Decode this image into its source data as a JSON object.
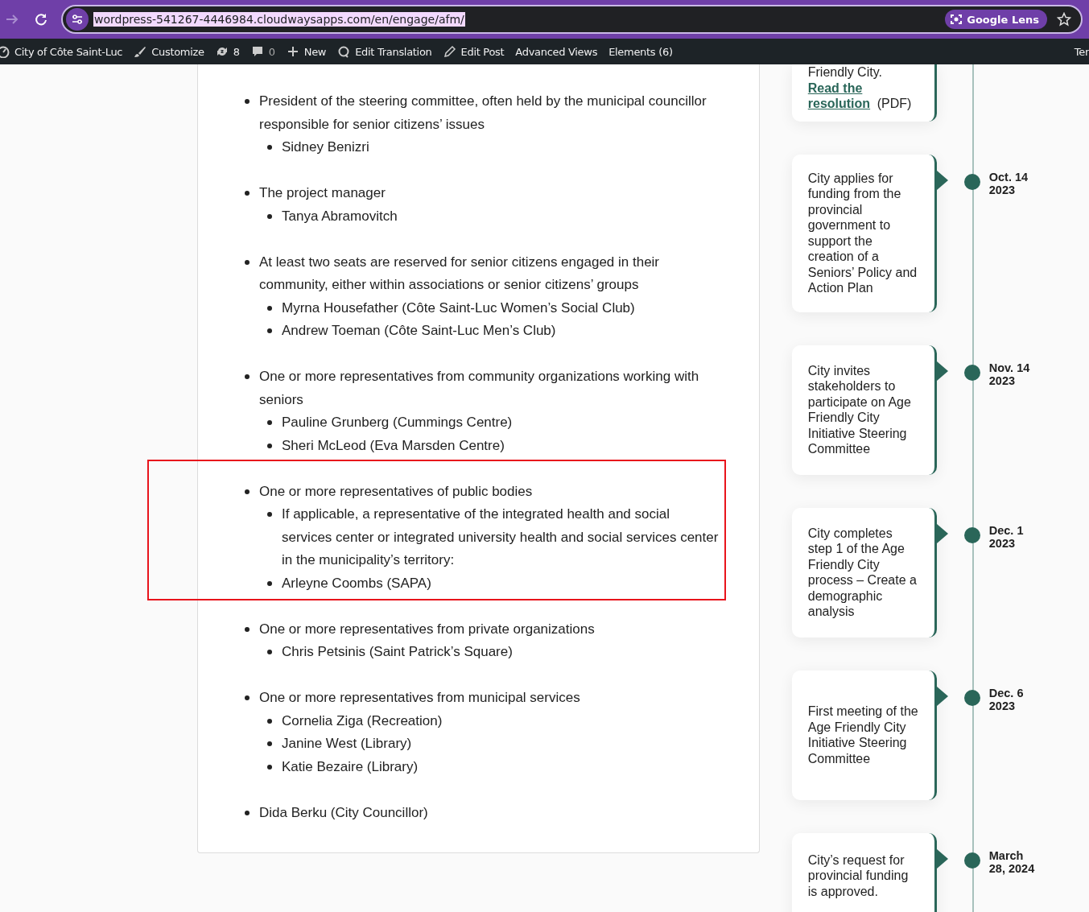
{
  "browser": {
    "url": "wordpress-541267-4446984.cloudwaysapps.com/en/engage/afm/",
    "lens_label": "Google Lens"
  },
  "admin_bar": {
    "items": [
      {
        "kind": "dashboard",
        "label": "City of Côte Saint-Luc"
      },
      {
        "kind": "brush",
        "label": "Customize"
      },
      {
        "kind": "refresh",
        "label": "8"
      },
      {
        "kind": "comment",
        "label": "0"
      },
      {
        "kind": "plus",
        "label": "New"
      },
      {
        "kind": "translate",
        "label": "Edit Translation"
      },
      {
        "kind": "pencil",
        "label": "Edit Post"
      },
      {
        "kind": "plain",
        "label": "Advanced Views"
      },
      {
        "kind": "plain",
        "label": "Elements (6)"
      }
    ],
    "right_label": "Ter"
  },
  "members": [
    {
      "text": "President of the steering committee, often held by the municipal councillor responsible for senior citizens’ issues",
      "highlighted": false,
      "children": [
        "Sidney Benizri"
      ]
    },
    {
      "text": "The project manager",
      "highlighted": false,
      "children": [
        "Tanya Abramovitch"
      ]
    },
    {
      "text": "At least two seats are reserved for senior citizens engaged in their community, either within associations or senior citizens’ groups",
      "highlighted": false,
      "children": [
        "Myrna Housefather (Côte Saint-Luc Women’s Social Club)",
        "Andrew Toeman (Côte Saint-Luc Men’s Club)"
      ]
    },
    {
      "text": "One or more representatives from community organizations working with seniors",
      "highlighted": false,
      "children": [
        "Pauline Grunberg (Cummings Centre)",
        "Sheri McLeod (Eva Marsden Centre)"
      ]
    },
    {
      "text": "One or more representatives of public bodies",
      "highlighted": true,
      "children": [
        "If applicable, a representative of the integrated health and social services center or integrated university health and social services center in the municipality’s territory:",
        "Arleyne Coombs (SAPA)"
      ]
    },
    {
      "text": "One or more representatives from private organizations",
      "highlighted": false,
      "children": [
        "Chris Petsinis (Saint Patrick’s Square)"
      ]
    },
    {
      "text": "One or more representatives from municipal services",
      "highlighted": false,
      "children": [
        "Cornelia Ziga (Recreation)",
        "Janine West (Library)",
        "Katie Bezaire (Library)"
      ]
    },
    {
      "text": "Dida Berku (City Councillor)",
      "highlighted": false
    }
  ],
  "timeline": {
    "partial_card": {
      "text": "Friendly City.",
      "link": "Read the resolution",
      "suffix": "(PDF)"
    },
    "events": [
      {
        "text": "City applies for funding from the provincial government to support the creation of a Seniors’ Policy and Action Plan",
        "date": "Oct. 14 2023"
      },
      {
        "text": "City invites stakeholders to participate on Age Friendly City Initiative Steering Committee",
        "date": "Nov. 14 2023"
      },
      {
        "text": "City completes step 1 of the Age Friendly City process – Create a demographic analysis",
        "date": "Dec. 1 2023"
      },
      {
        "text": "First meeting of the Age Friendly City Initiative Steering Committee",
        "date": "Dec. 6 2023"
      },
      {
        "text": "City’s request for provincial funding is approved.",
        "date": "March 28, 2024"
      }
    ]
  }
}
